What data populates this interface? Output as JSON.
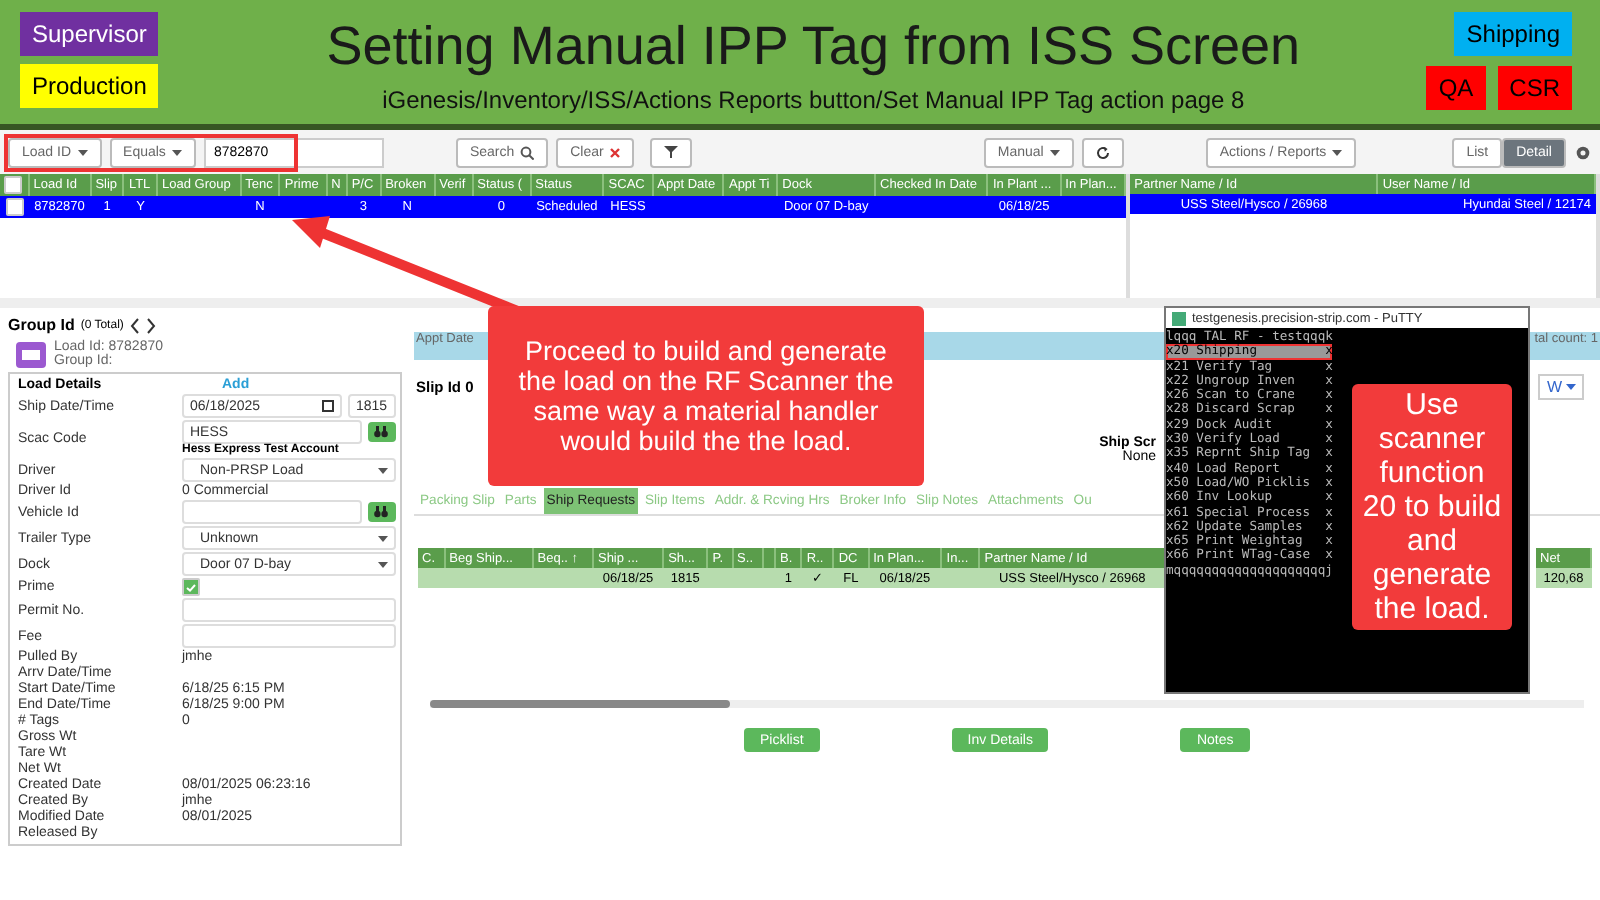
{
  "slide": {
    "badges_left": [
      {
        "label": "Supervisor",
        "color": "#7030a0"
      },
      {
        "label": "Production",
        "color": "#ffff00"
      }
    ],
    "title": "Setting Manual IPP Tag from ISS Screen",
    "subtitle": "iGenesis/Inventory/ISS/Actions Reports button/Set Manual IPP Tag action page 8",
    "badges_right": [
      {
        "label": "Shipping",
        "color": "#00b0f0"
      },
      {
        "label": "QA",
        "color": "#ff0000"
      },
      {
        "label": "CSR",
        "color": "#ff0000"
      }
    ]
  },
  "toolbar": {
    "field_filter": "Load ID",
    "operator": "Equals",
    "search_value": "8782870",
    "search_button": "Search",
    "clear_button": "Clear",
    "mode": "Manual",
    "actions": "Actions / Reports",
    "views": [
      {
        "label": "List",
        "selected": false
      },
      {
        "label": "Detail",
        "selected": true
      }
    ]
  },
  "loads_table": {
    "select_all": false,
    "columns": [
      "Load Id",
      "Slip",
      "LTL",
      "Load Group",
      "Tenc",
      "Prime",
      "N",
      "P/C",
      "Broken",
      "Verif",
      "Status (",
      "Status",
      "SCAC",
      "Appt Date",
      "Appt Ti",
      "Dock",
      "Checked In Date",
      "In Plant ...",
      "In Plan..."
    ],
    "rows": [
      {
        "selected": true,
        "checked": false,
        "cells": [
          "8782870",
          "1",
          "Y",
          null,
          "N",
          null,
          null,
          "3",
          "N",
          null,
          "0",
          "Scheduled",
          "HESS",
          null,
          null,
          "Door 07 D-bay",
          null,
          "06/18/25",
          null
        ]
      }
    ]
  },
  "side_table": {
    "columns": [
      "Partner Name / Id",
      "User Name / Id"
    ],
    "rows": [
      {
        "selected": true,
        "cells": [
          "USS Steel/Hysco / 26968",
          "Hyundai Steel / 12174"
        ]
      }
    ]
  },
  "group": {
    "title": "Group Id",
    "count": "(0 Total)",
    "load_id": "Load Id: 8782870",
    "group_id": "Group Id:"
  },
  "details": {
    "title": "Load Details",
    "add": "Add",
    "fields": [
      {
        "label": "Ship Date/Time",
        "kind": "datetime",
        "value": "06/18/2025",
        "time": "1815"
      },
      {
        "label": "Scac Code",
        "kind": "lookup",
        "value": "HESS",
        "note": "Hess Express Test Account"
      },
      {
        "label": "Driver",
        "kind": "select",
        "value": "Non-PRSP Load"
      },
      {
        "label": "Driver Id",
        "kind": "text",
        "value": "0 Commercial"
      },
      {
        "label": "Vehicle Id",
        "kind": "lookup"
      },
      {
        "label": "Trailer Type",
        "kind": "select",
        "value": "Unknown"
      },
      {
        "label": "Dock",
        "kind": "select",
        "value": "Door 07 D-bay"
      },
      {
        "label": "Prime",
        "kind": "checkbox",
        "checked": true
      },
      {
        "label": "Permit No.",
        "kind": "input"
      },
      {
        "label": "Fee",
        "kind": "input"
      },
      {
        "label": "Pulled By",
        "kind": "text",
        "value": "jmhe"
      },
      {
        "label": "Arrv Date/Time",
        "kind": "text"
      },
      {
        "label": "Start Date/Time",
        "kind": "text",
        "value": "6/18/25 6:15 PM"
      },
      {
        "label": "End Date/Time",
        "kind": "text",
        "value": "6/18/25 9:00 PM"
      },
      {
        "label": "# Tags",
        "kind": "text",
        "value": "0"
      },
      {
        "label": "Gross Wt",
        "kind": "text"
      },
      {
        "label": "Tare Wt",
        "kind": "text"
      },
      {
        "label": "Net Wt",
        "kind": "text"
      },
      {
        "label": "Created Date",
        "kind": "text",
        "value": "08/01/2025 06:23:16"
      },
      {
        "label": "Created By",
        "kind": "text",
        "value": "jmhe"
      },
      {
        "label": "Modified Date",
        "kind": "text",
        "value": "08/01/2025"
      },
      {
        "label": "Released By",
        "kind": "text"
      }
    ]
  },
  "slip": {
    "appt_label": "Appt Date",
    "title": "Slip Id 0",
    "total": "tal count: 1",
    "w_button": "W",
    "ship_screen_label": "Ship Scr",
    "ship_screen_value": "None",
    "tabs": [
      {
        "label": "Packing Slip",
        "selected": false
      },
      {
        "label": "Parts",
        "selected": false
      },
      {
        "label": "Ship Requests",
        "selected": true
      },
      {
        "label": "Slip Items",
        "selected": false
      },
      {
        "label": "Addr. & Rcving Hrs",
        "selected": false
      },
      {
        "label": "Broker Info",
        "selected": false
      },
      {
        "label": "Slip Notes",
        "selected": false
      },
      {
        "label": "Attachments",
        "selected": false
      },
      {
        "label": "Ou",
        "selected": false
      }
    ],
    "columns": [
      "C.",
      "Beg Ship...",
      "Beq.. ↑",
      "Ship ...",
      "Sh...",
      "P.",
      "S..",
      null,
      "B.",
      "R..",
      "DC",
      "In Plan...",
      "In...",
      "Partner Name / Id"
    ],
    "right_columns": [
      "Net"
    ],
    "rows": [
      {
        "cells": [
          null,
          null,
          null,
          "06/18/25",
          "1815",
          null,
          null,
          null,
          "1",
          "✓",
          "FL",
          "06/18/25",
          null,
          "USS Steel/Hysco / 26968"
        ],
        "right_cells": [
          "120,68"
        ]
      }
    ],
    "buttons": [
      "Picklist",
      "Inv Details",
      "Notes"
    ]
  },
  "putty": {
    "title": "testgenesis.precision-strip.com - PuTTY",
    "header": "lqqq TAL RF - testqqqk",
    "items": [
      {
        "text": "x20 Shipping         x",
        "selected": true
      },
      {
        "text": "x21 Verify Tag       x",
        "selected": false
      },
      {
        "text": "x22 Ungroup Inven    x",
        "selected": false
      },
      {
        "text": "x26 Scan to Crane    x",
        "selected": false
      },
      {
        "text": "x28 Discard Scrap    x",
        "selected": false
      },
      {
        "text": "x29 Dock Audit       x",
        "selected": false
      },
      {
        "text": "x30 Verify Load      x",
        "selected": false
      },
      {
        "text": "x35 Reprnt Ship Tag  x",
        "selected": false
      },
      {
        "text": "x40 Load Report      x",
        "selected": false
      },
      {
        "text": "x50 Load/WO Picklis  x",
        "selected": false
      },
      {
        "text": "x60 Inv Lookup       x",
        "selected": false
      },
      {
        "text": "x61 Special Process  x",
        "selected": false
      },
      {
        "text": "x62 Update Samples   x",
        "selected": false
      },
      {
        "text": "x65 Print Weightag   x",
        "selected": false
      },
      {
        "text": "x66 Print WTag-Case  x",
        "selected": false
      }
    ],
    "footer": "mqqqqqqqqqqqqqqqqqqqqj"
  },
  "callouts": [
    {
      "text": "Proceed to build and generate the load on the RF Scanner the same way a material handler would build the the load."
    },
    {
      "text": "Use scanner function 20 to build and generate the load."
    }
  ]
}
